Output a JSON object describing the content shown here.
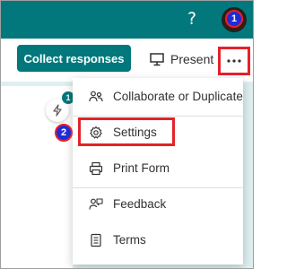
{
  "header": {
    "help_glyph": "?",
    "accent_color": "#03787c"
  },
  "toolbar": {
    "collect_label": "Collect responses",
    "present_label": "Present",
    "more_glyph": "···"
  },
  "side_panel": {
    "badge": "1"
  },
  "menu": {
    "items": [
      {
        "label": "Collaborate or Duplicate",
        "icon": "people-icon"
      },
      {
        "label": "Settings",
        "icon": "gear-icon"
      },
      {
        "label": "Print Form",
        "icon": "printer-icon"
      },
      {
        "label": "Feedback",
        "icon": "feedback-icon"
      },
      {
        "label": "Terms",
        "icon": "document-icon"
      }
    ]
  },
  "annotations": {
    "step1": "1",
    "step2": "2",
    "highlight_color": "#e4222a",
    "marker_color": "#1f2bd6"
  }
}
